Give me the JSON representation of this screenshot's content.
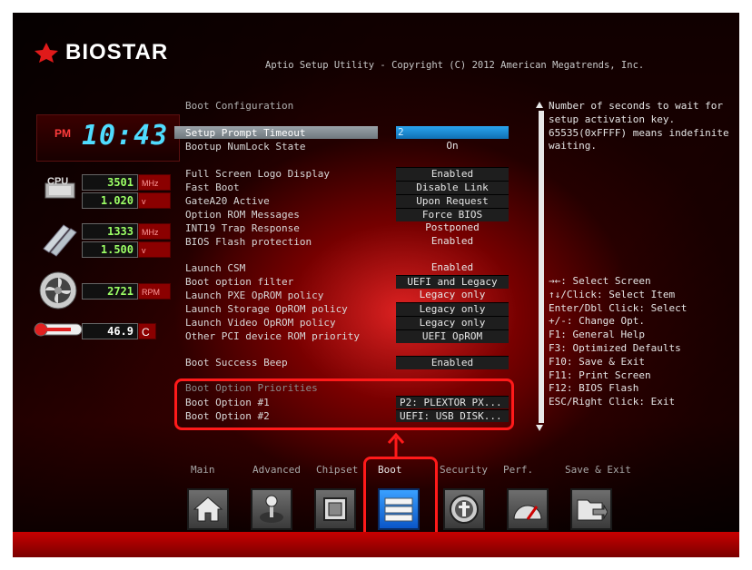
{
  "header": {
    "logo_text": "BIOSTAR",
    "copyright": "Aptio Setup Utility - Copyright (C) 2012 American Megatrends, Inc."
  },
  "widgets": {
    "clock": {
      "ampm": "PM",
      "time": "10:43"
    },
    "cpu": {
      "label": "CPU",
      "freq": "3501",
      "freq_unit": "MHz",
      "voltage": "1.020",
      "voltage_unit": "v"
    },
    "memory": {
      "freq": "1333",
      "freq_unit": "MHz",
      "voltage": "1.500",
      "voltage_unit": "v"
    },
    "fan": {
      "rpm": "2721",
      "unit": "RPM"
    },
    "temperature": {
      "value": "46.9",
      "unit": "C"
    }
  },
  "boot": {
    "section_title": "Boot Configuration",
    "rows": [
      {
        "label": "Setup Prompt Timeout",
        "value": "2"
      },
      {
        "label": "Bootup NumLock State",
        "value": "On"
      },
      {
        "label": "Full Screen Logo Display",
        "value": "Enabled"
      },
      {
        "label": "Fast Boot",
        "value": "Disable Link"
      },
      {
        "label": "GateA20 Active",
        "value": "Upon Request"
      },
      {
        "label": "Option ROM Messages",
        "value": "Force BIOS"
      },
      {
        "label": "INT19 Trap Response",
        "value": "Postponed"
      },
      {
        "label": "BIOS Flash protection",
        "value": "Enabled"
      },
      {
        "label": "Launch CSM",
        "value": "Enabled"
      },
      {
        "label": "Boot option filter",
        "value": "UEFI and Legacy"
      },
      {
        "label": "Launch PXE OpROM policy",
        "value": "Legacy only"
      },
      {
        "label": "Launch Storage OpROM policy",
        "value": "Legacy only"
      },
      {
        "label": "Launch Video OpROM policy",
        "value": "Legacy only"
      },
      {
        "label": "Other PCI device ROM priority",
        "value": "UEFI OpROM"
      },
      {
        "label": "Boot Success Beep",
        "value": "Enabled"
      }
    ],
    "priorities_title": "Boot Option Priorities",
    "priorities": [
      {
        "label": "Boot Option #1",
        "value": "P2: PLEXTOR  PX..."
      },
      {
        "label": "Boot Option #2",
        "value": "UEFI:  USB DISK..."
      }
    ]
  },
  "help": {
    "description": "Number of seconds to wait for\nsetup activation key.\n65535(0xFFFF) means indefinite\nwaiting.",
    "keys": "→←: Select Screen\n↑↓/Click: Select Item\nEnter/Dbl Click: Select\n+/-: Change Opt.\nF1: General Help\nF3: Optimized Defaults\nF10: Save & Exit\nF11: Print Screen\nF12: BIOS Flash\nESC/Right Click: Exit"
  },
  "tabs": [
    {
      "label": "Main",
      "icon": "home-icon"
    },
    {
      "label": "Advanced",
      "icon": "joystick-icon"
    },
    {
      "label": "Chipset",
      "icon": "chip-icon"
    },
    {
      "label": "Boot",
      "icon": "drive-stack-icon",
      "active": true
    },
    {
      "label": "Security",
      "icon": "shield-icon"
    },
    {
      "label": "Perf.",
      "icon": "gauge-icon"
    },
    {
      "label": "Save & Exit",
      "icon": "folder-exit-icon"
    }
  ],
  "colors": {
    "accent": "#ff1a1a",
    "selected_value": "#1f8ad8",
    "active_tab": "#1a78e6"
  }
}
